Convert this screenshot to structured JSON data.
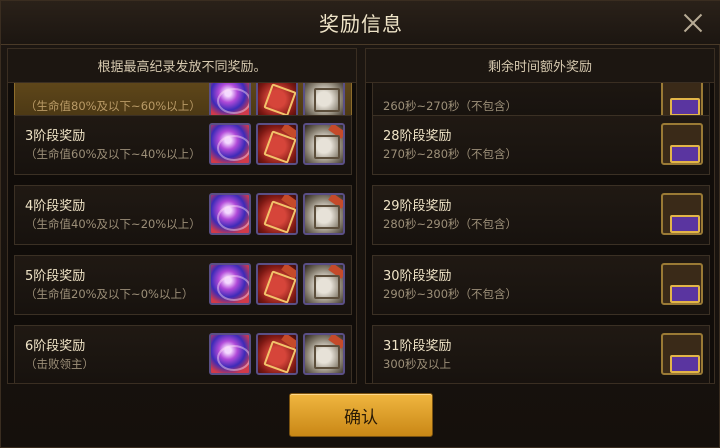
{
  "dialog": {
    "title": "奖励信息",
    "confirm_label": "确认"
  },
  "left_panel": {
    "header": "根据最高纪录发放不同奖励。",
    "partial_row_text": "（生命值80%及以下~60%以上）",
    "rows": [
      {
        "title": "3阶段奖励",
        "subtitle": "（生命值60%及以下~40%以上）",
        "items": [
          "orb-icon",
          "red-chest-icon",
          "silver-chest-icon"
        ]
      },
      {
        "title": "4阶段奖励",
        "subtitle": "（生命值40%及以下~20%以上）",
        "items": [
          "orb-icon",
          "red-chest-icon",
          "silver-chest-icon"
        ]
      },
      {
        "title": "5阶段奖励",
        "subtitle": "（生命值20%及以下~0%以上）",
        "items": [
          "orb-icon",
          "red-chest-icon",
          "silver-chest-icon"
        ]
      },
      {
        "title": "6阶段奖励",
        "subtitle": "（击败领主）",
        "items": [
          "orb-icon",
          "red-chest-icon",
          "silver-chest-icon"
        ]
      }
    ]
  },
  "right_panel": {
    "header": "剩余时间额外奖励",
    "partial_row_text": "260秒~270秒（不包含）",
    "rows": [
      {
        "title": "28阶段奖励",
        "subtitle": "270秒~280秒（不包含）",
        "items": [
          "treasure-chest-icon"
        ]
      },
      {
        "title": "29阶段奖励",
        "subtitle": "280秒~290秒（不包含）",
        "items": [
          "treasure-chest-icon"
        ]
      },
      {
        "title": "30阶段奖励",
        "subtitle": "290秒~300秒（不包含）",
        "items": [
          "treasure-chest-icon"
        ]
      },
      {
        "title": "31阶段奖励",
        "subtitle": "300秒及以上",
        "items": [
          "treasure-chest-icon"
        ]
      }
    ]
  }
}
